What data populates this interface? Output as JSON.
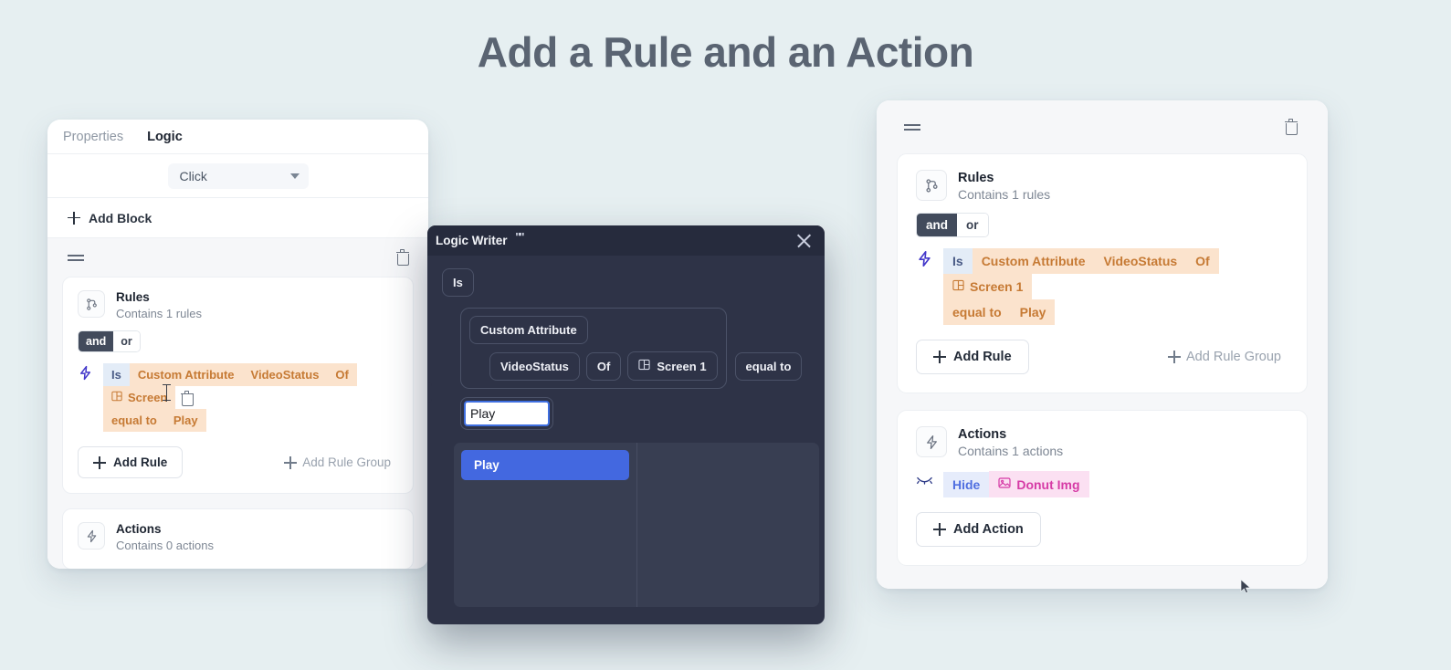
{
  "page": {
    "title": "Add a Rule and an Action",
    "background_color": "#e6eff1",
    "title_color": "#5a6472"
  },
  "left_panel": {
    "tabs": [
      {
        "label": "Properties",
        "active": false
      },
      {
        "label": "Logic",
        "active": true
      }
    ],
    "trigger_select": {
      "value": "Click",
      "icon": "chevron-down-icon"
    },
    "add_block_label": "Add Block",
    "block": {
      "drag_handle_icon": "drag-handle-icon",
      "delete_icon": "trash-icon",
      "rules": {
        "icon": "git-branch-icon",
        "title": "Rules",
        "subtitle": "Contains 1 rules",
        "operator_toggle": {
          "options": [
            "and",
            "or"
          ],
          "selected": "and"
        },
        "rule": {
          "bolt_icon": "lightning-bolt-icon",
          "chips": [
            {
              "text": "Is",
              "style": "is"
            },
            {
              "text": "Custom Attribute",
              "style": "attr"
            },
            {
              "text": "VideoStatus",
              "style": "attr"
            },
            {
              "text": "Of",
              "style": "attr"
            },
            {
              "text": "Screen",
              "style": "attr",
              "icon": "screen-layout-icon"
            }
          ],
          "chips_line2": [
            {
              "text": "equal to",
              "style": "attr"
            },
            {
              "text": "Play",
              "style": "attr"
            }
          ],
          "delete_icon": "trash-icon"
        },
        "add_rule_label": "Add Rule",
        "add_rule_group_label": "Add Rule Group"
      },
      "actions": {
        "icon": "lightning-bolt-icon",
        "title": "Actions",
        "subtitle": "Contains 0 actions"
      }
    }
  },
  "modal": {
    "title": "Logic Writer",
    "title_artifact": "\"\"",
    "close_icon": "close-icon",
    "background_color": "#2e3347",
    "tokens": {
      "operator": "Is",
      "group": {
        "head": "Custom Attribute",
        "row": [
          {
            "text": "VideoStatus"
          },
          {
            "text": "Of"
          },
          {
            "text": "Screen 1",
            "icon": "screen-layout-icon"
          }
        ]
      },
      "comparator": "equal to"
    },
    "input": {
      "value": "Play",
      "placeholder": ""
    },
    "suggestions": {
      "left_column": [
        {
          "label": "Play",
          "selected": true
        }
      ],
      "right_column": []
    }
  },
  "right_panel": {
    "drag_handle_icon": "drag-handle-icon",
    "delete_icon": "trash-icon",
    "rules": {
      "icon": "git-branch-icon",
      "title": "Rules",
      "subtitle": "Contains 1 rules",
      "operator_toggle": {
        "options": [
          "and",
          "or"
        ],
        "selected": "and"
      },
      "rule": {
        "bolt_icon": "lightning-bolt-icon",
        "chips": [
          {
            "text": "Is",
            "style": "is"
          },
          {
            "text": "Custom Attribute",
            "style": "attr"
          },
          {
            "text": "VideoStatus",
            "style": "attr"
          },
          {
            "text": "Of",
            "style": "attr"
          },
          {
            "text": "Screen 1",
            "style": "attr",
            "icon": "screen-layout-icon"
          }
        ],
        "chips_line2": [
          {
            "text": "equal to",
            "style": "attr"
          },
          {
            "text": "Play",
            "style": "attr"
          }
        ]
      },
      "add_rule_label": "Add Rule",
      "add_rule_group_label": "Add Rule Group"
    },
    "actions": {
      "icon": "lightning-bolt-icon",
      "title": "Actions",
      "subtitle": "Contains 1 actions",
      "action": {
        "eye_off_icon": "eye-off-icon",
        "chips": [
          {
            "text": "Hide",
            "style": "hide"
          },
          {
            "text": "Donut Img",
            "style": "donut",
            "icon": "image-icon"
          }
        ]
      },
      "add_action_label": "Add Action"
    }
  },
  "colors": {
    "chip_attr_text": "#c67a34",
    "chip_attr_bg": "#fbe3cd",
    "chip_is_text": "#4a5b86",
    "chip_is_bg": "#e3ecf7",
    "chip_hide_text": "#4f6ee0",
    "chip_donut_text": "#d63ba6",
    "modal_accent": "#4368e0"
  }
}
